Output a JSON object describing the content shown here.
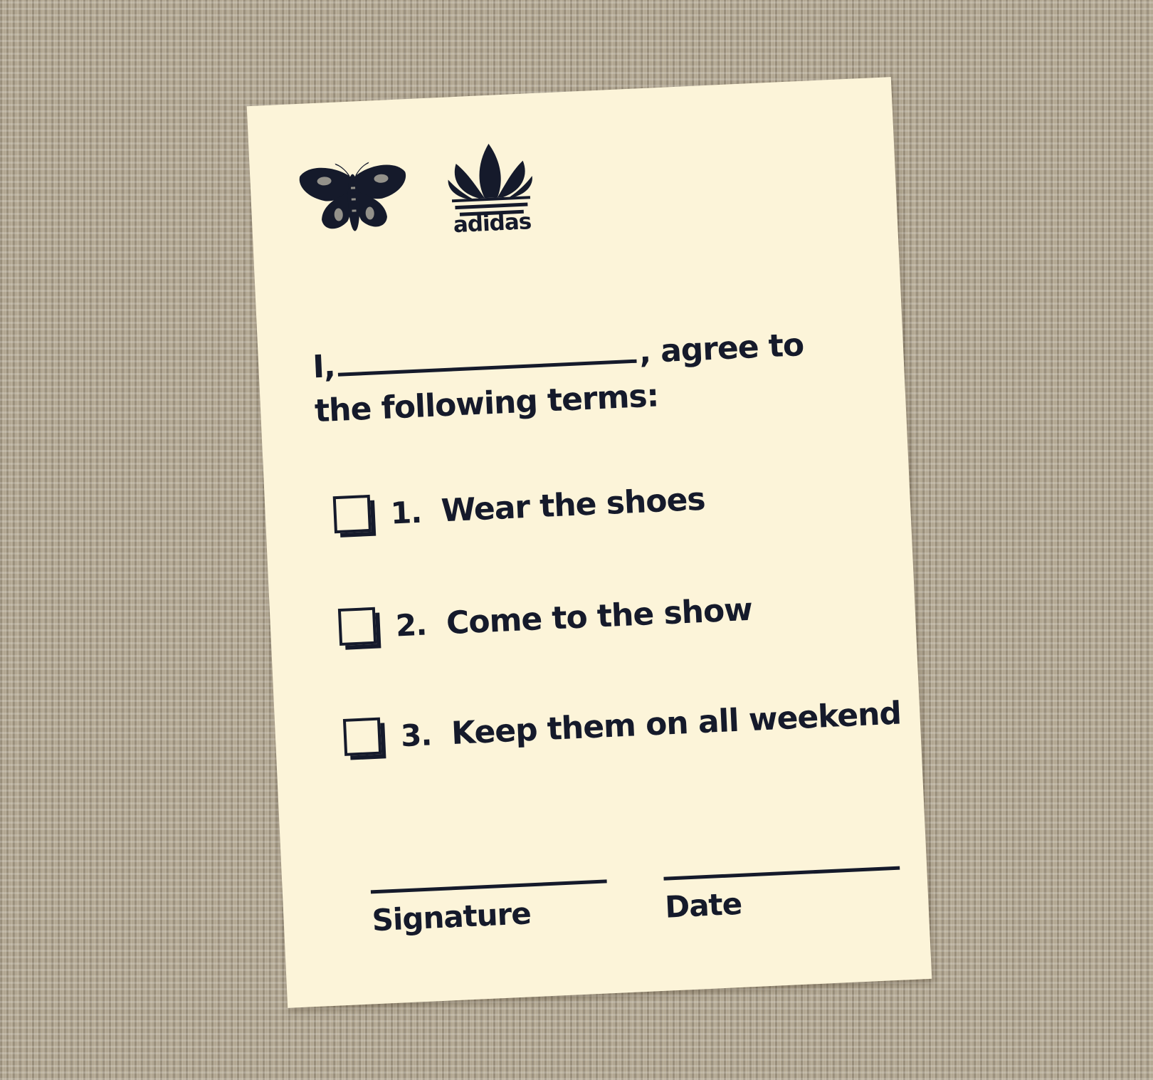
{
  "card": {
    "background_color": "#fcf4d9",
    "ink_color": "#151a2b",
    "logos": {
      "moth_icon": "moth-logo-icon",
      "adidas_icon": "adidas-trefoil-icon",
      "adidas_wordmark": "adidas"
    },
    "intro": {
      "prefix": "I,",
      "suffix": ", agree to",
      "line2": "the following terms:"
    },
    "terms": [
      {
        "number": "1.",
        "text": "Wear the shoes",
        "checked": false
      },
      {
        "number": "2.",
        "text": "Come to the show",
        "checked": false
      },
      {
        "number": "3.",
        "text": "Keep them on all weekend",
        "checked": false
      }
    ],
    "signature_label": "Signature",
    "date_label": "Date"
  }
}
